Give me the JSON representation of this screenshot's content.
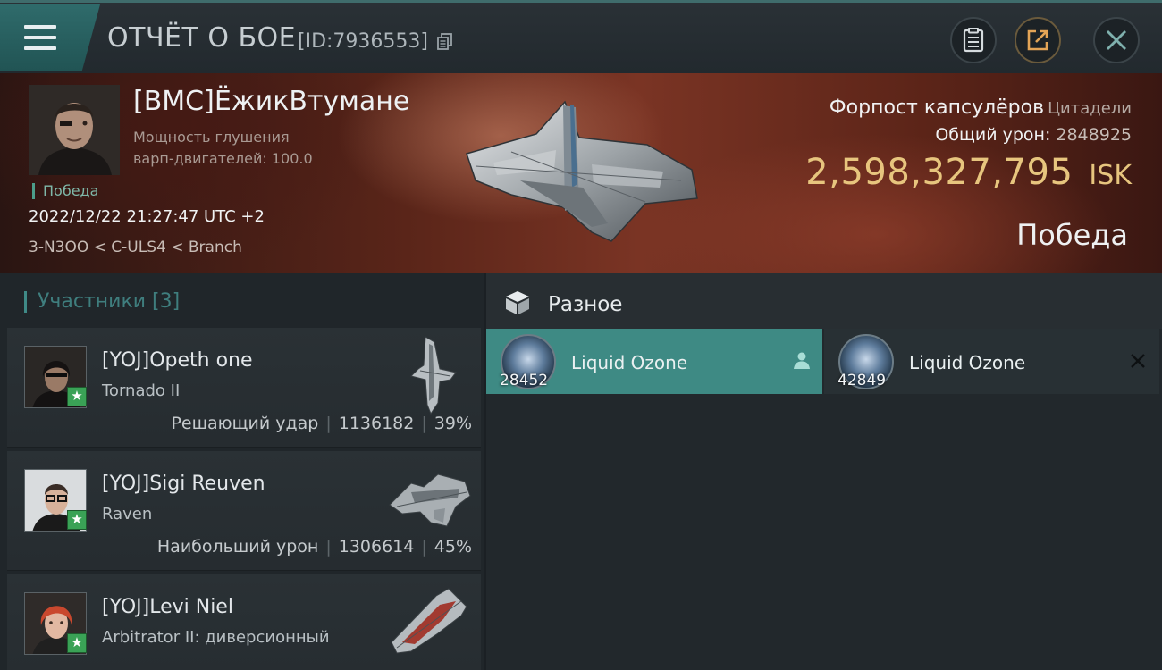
{
  "header": {
    "title": "ОТЧЁТ О БОЕ",
    "report_id": "[ID:7936553]",
    "icons": [
      "menu-icon",
      "copy-icon",
      "clipboard-icon",
      "share-icon",
      "close-icon"
    ]
  },
  "victim": {
    "pilot": "[BMC]ЁжикВтумане",
    "warp_line1": "Мощность глушения",
    "warp_line2": "варп-двигателей: 100.0",
    "badge": "Победа",
    "datetime": "2022/12/22 21:27:47 UTC +2",
    "location": "3-N3OO < C-ULS4 < Branch",
    "ship_name": "Форпост капсулёров",
    "ship_category": "Цитадели",
    "total_damage_label": "Общий урон:",
    "total_damage_value": "2848925",
    "isk_value": "2,598,327,795",
    "isk_unit": "ISK",
    "result": "Победа"
  },
  "participants": {
    "title": "Участники [3]",
    "rows": [
      {
        "name": "[YOJ]Opeth one",
        "ship": "Tornado II",
        "stat_label": "Решающий удар",
        "damage": "1136182",
        "percent": "39%"
      },
      {
        "name": "[YOJ]Sigi Reuven",
        "ship": "Raven",
        "stat_label": "Наибольший урон",
        "damage": "1306614",
        "percent": "45%"
      },
      {
        "name": "[YOJ]Levi Niel",
        "ship": "Arbitrator II: диверсионный",
        "stat_label": "",
        "damage": "",
        "percent": ""
      }
    ]
  },
  "misc": {
    "title": "Разное",
    "items": [
      {
        "name": "Liquid Ozone",
        "qty": "28452",
        "state": "dropped"
      },
      {
        "name": "Liquid Ozone",
        "qty": "42849",
        "state": "destroyed"
      }
    ]
  },
  "colors": {
    "accent_teal": "#3e8a84",
    "isk_gold": "#e7c57e",
    "win_green": "#4c9e8a",
    "star_green": "#3aa256"
  }
}
